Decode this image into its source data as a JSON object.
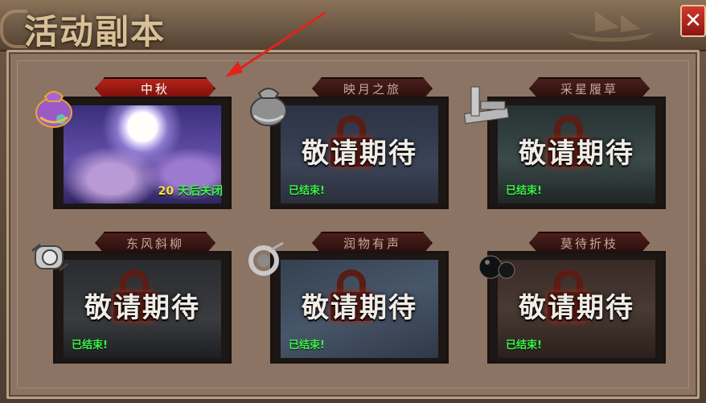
{
  "window": {
    "title": "活动副本",
    "close_icon": "close-icon",
    "accent": "#c8301f"
  },
  "cards": [
    {
      "name": "中秋",
      "status_number": "20",
      "status_text": "天后关闭",
      "locked": false,
      "icon": "purple-pouch-icon"
    },
    {
      "name": "映月之旅",
      "coming_soon": "敬请期待",
      "ended": "已结束!",
      "locked": true,
      "icon": "silver-pouch-icon"
    },
    {
      "name": "采星履草",
      "coming_soon": "敬请期待",
      "ended": "已结束!",
      "locked": true,
      "icon": "silver-bars-icon"
    },
    {
      "name": "东风斜柳",
      "coming_soon": "敬请期待",
      "ended": "已结束!",
      "locked": true,
      "icon": "scroll-icon"
    },
    {
      "name": "润物有声",
      "coming_soon": "敬请期待",
      "ended": "已结束!",
      "locked": true,
      "icon": "silver-ring-icon"
    },
    {
      "name": "莫待折枝",
      "coming_soon": "敬请期待",
      "ended": "已结束!",
      "locked": true,
      "icon": "black-orb-icon"
    }
  ]
}
